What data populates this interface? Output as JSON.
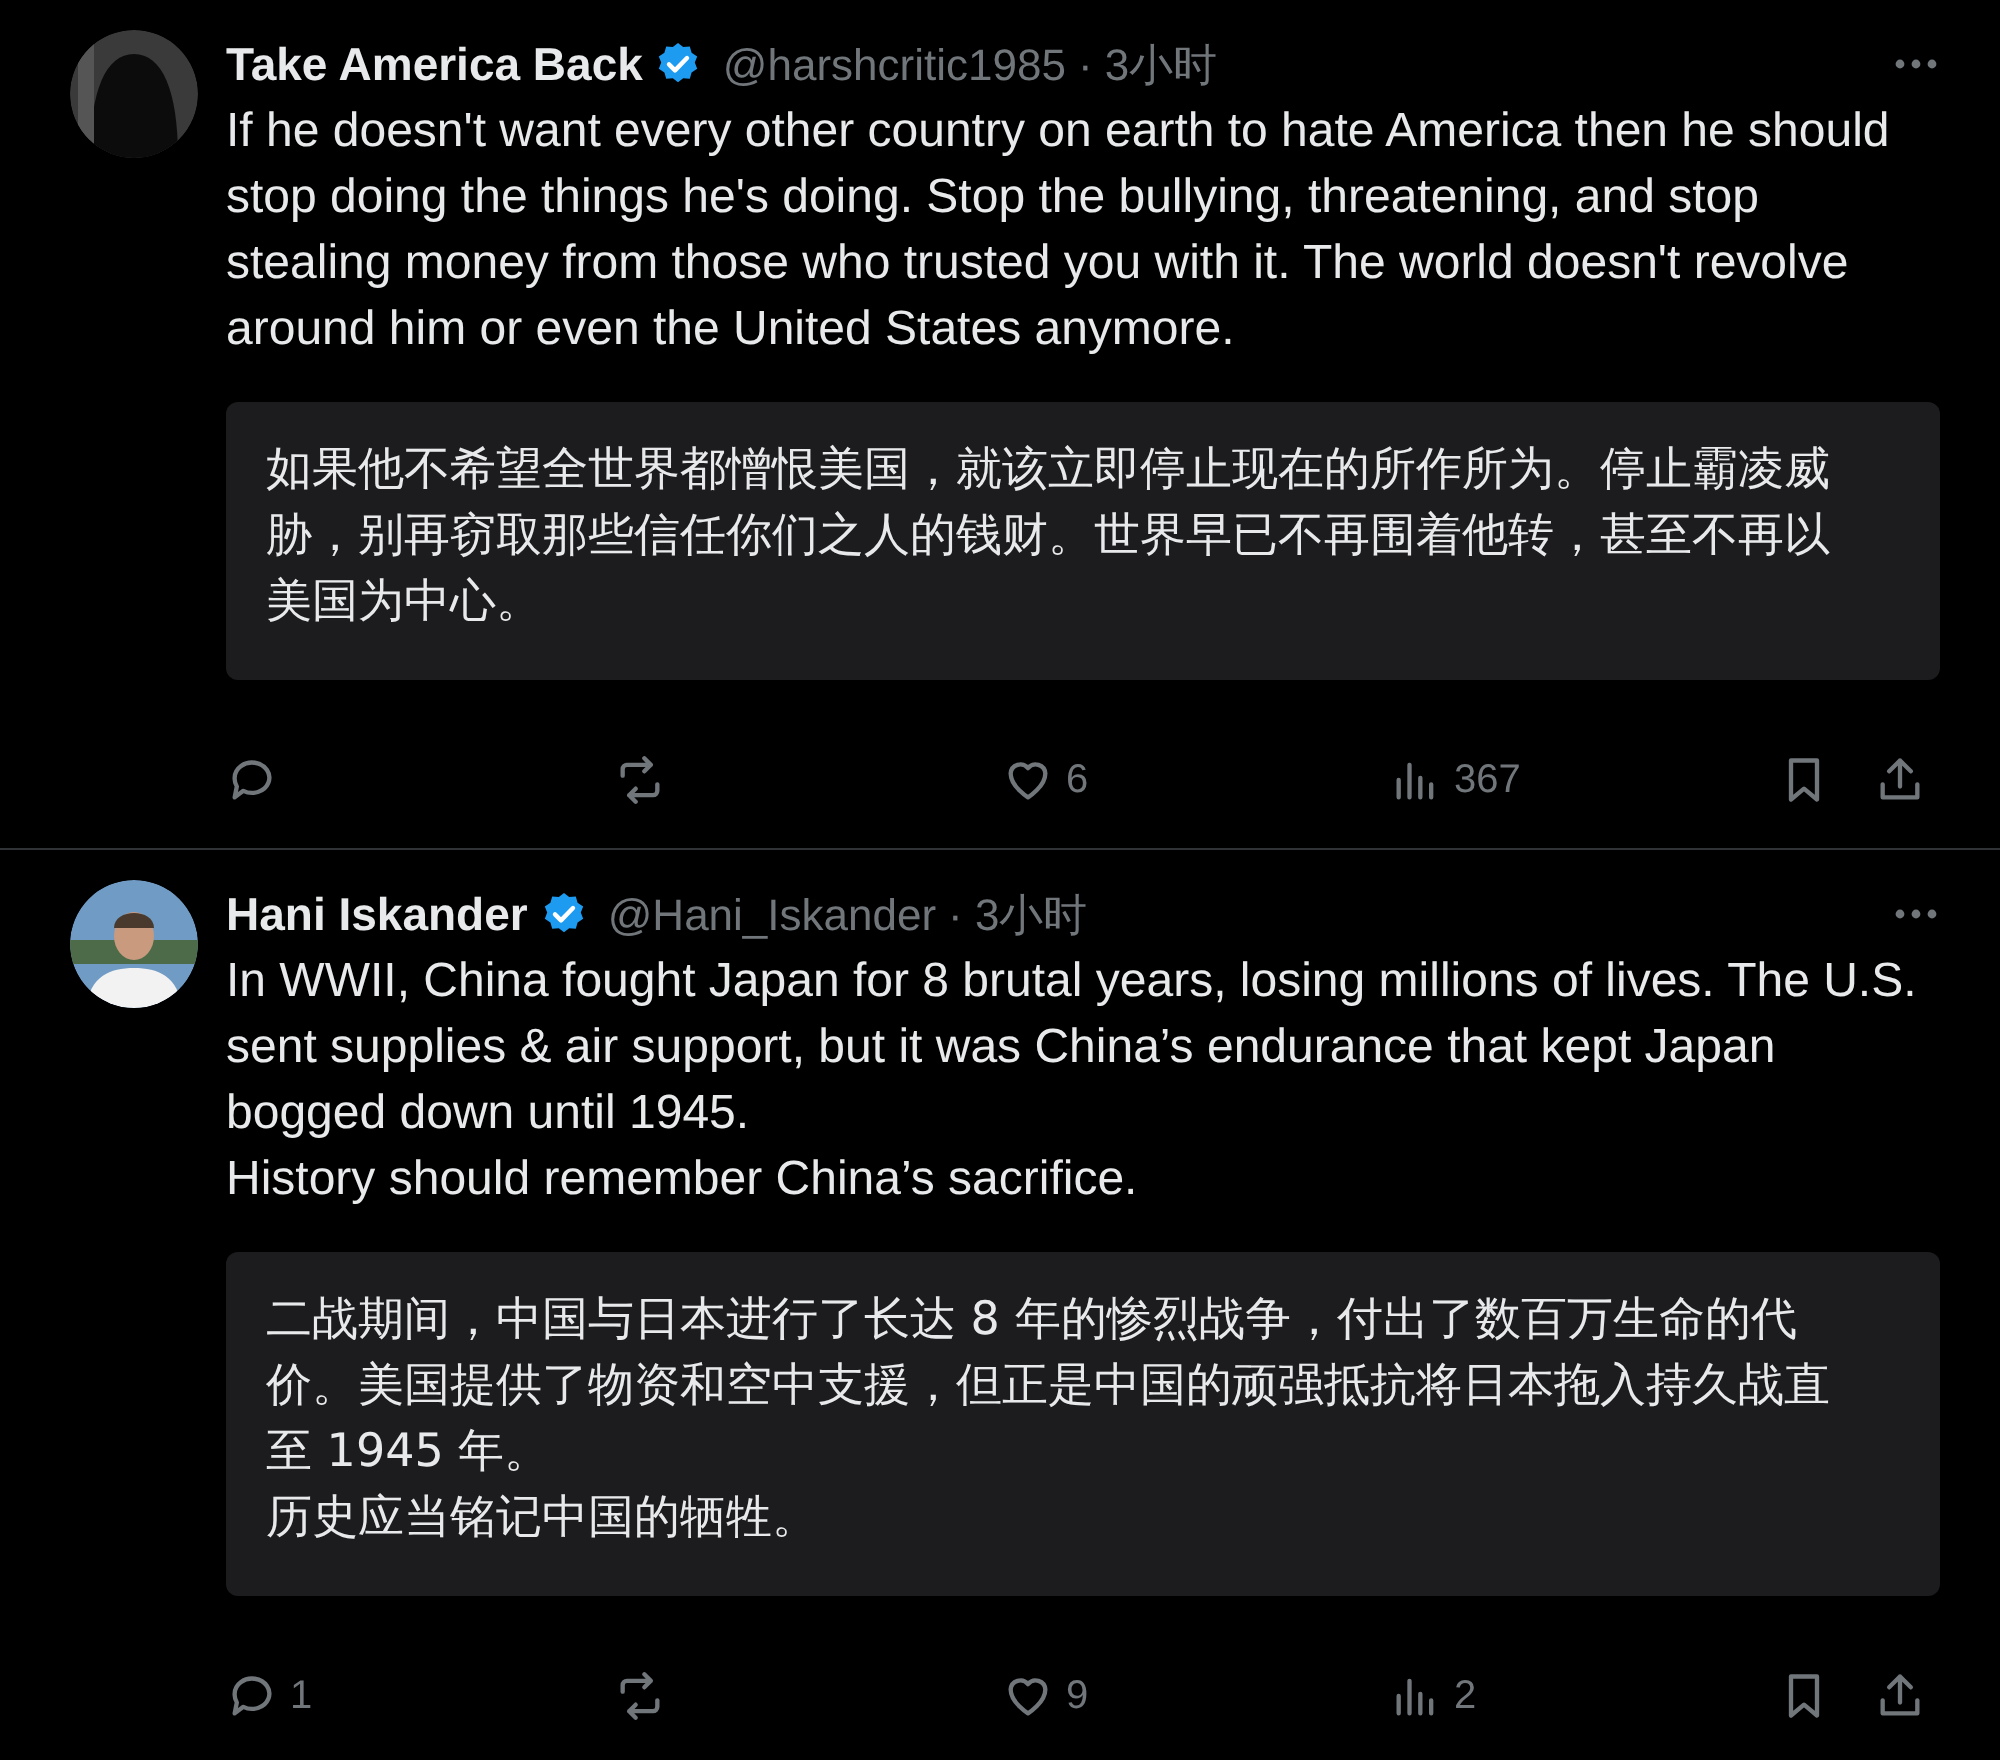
{
  "tweets": [
    {
      "name": "Take America Back",
      "verified": true,
      "handle": "@harshcritic1985",
      "time": "· 3小时",
      "text": [
        "If he doesn't want every other country on earth to hate America then he should stop doing the things he's doing. Stop the bullying, threatening, and stop stealing money from those who trusted you with it. The world doesn't revolve around him or even the United States anymore."
      ],
      "translation": [
        "如果他不希望全世界都憎恨美国，就该立即停止现在的所作所为。停止霸凌威胁，别再窃取那些信任你们之人的钱财。世界早已不再围着他转，甚至不再以美国为中心。"
      ],
      "likes": "6",
      "views": "367"
    },
    {
      "name": "Hani Iskander",
      "verified": true,
      "handle": "@Hani_Iskander",
      "time": "· 3小时",
      "text": [
        "In WWII, China fought Japan for 8 brutal years, losing millions of lives. The U.S. sent supplies & air support, but it was China’s endurance that kept Japan bogged down until 1945.",
        "History should remember China’s sacrifice."
      ],
      "translation": [
        "二战期间，中国与日本进行了长达 8 年的惨烈战争，付出了数百万生命的代价。美国提供了物资和空中支援，但正是中国的顽强抵抗将日本拖入持久战直至 1945 年。",
        "历史应当铭记中国的牺牲。"
      ],
      "replies": "1",
      "likes": "9",
      "views": "2"
    }
  ]
}
